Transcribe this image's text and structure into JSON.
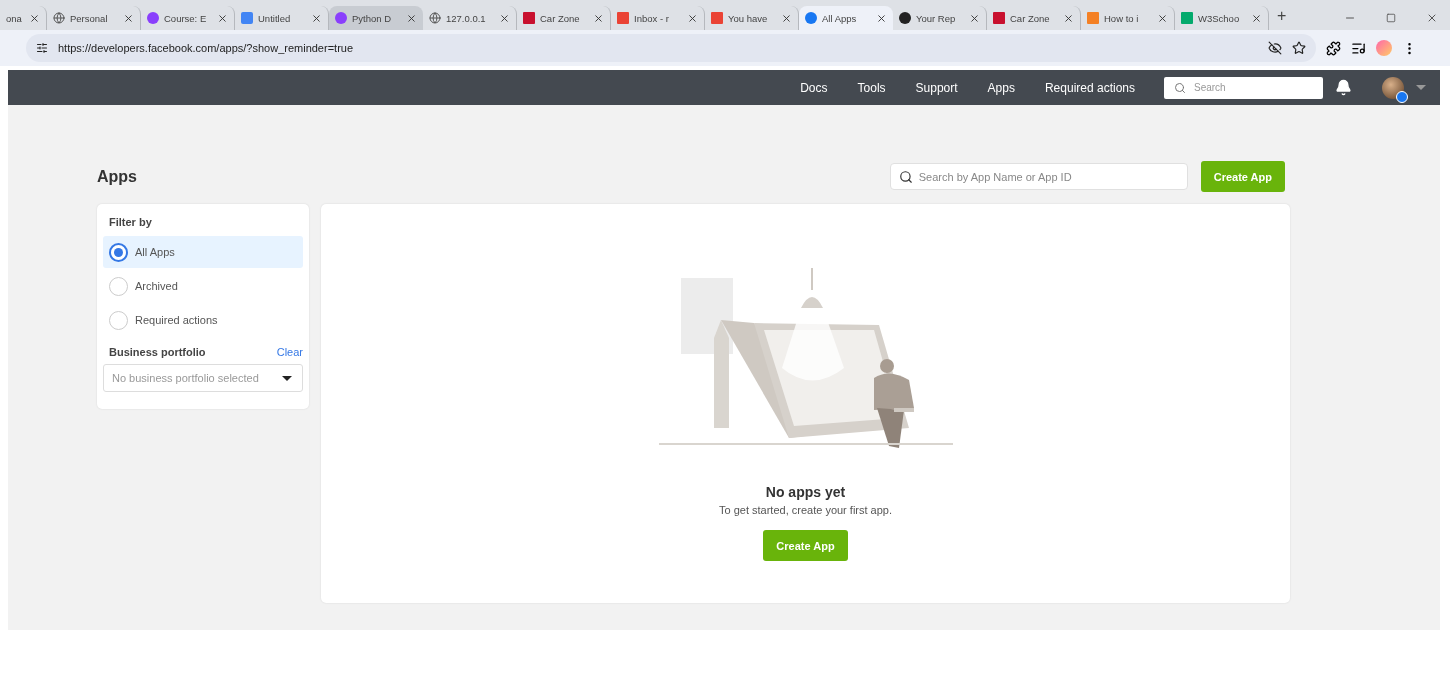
{
  "browser": {
    "tabs": [
      {
        "label": "ona",
        "kind": "plain",
        "selected": false,
        "hovered": false
      },
      {
        "label": "Personal",
        "kind": "globe",
        "selected": false,
        "hovered": false
      },
      {
        "label": "Course: E",
        "kind": "u",
        "selected": false,
        "hovered": false
      },
      {
        "label": "Untitled",
        "kind": "doc",
        "selected": false,
        "hovered": false
      },
      {
        "label": "Python D",
        "kind": "u",
        "selected": false,
        "hovered": true
      },
      {
        "label": "127.0.0.1",
        "kind": "globe",
        "selected": false,
        "hovered": false
      },
      {
        "label": "Car Zone",
        "kind": "flag",
        "selected": false,
        "hovered": false
      },
      {
        "label": "Inbox - r",
        "kind": "mail",
        "selected": false,
        "hovered": false
      },
      {
        "label": "You have",
        "kind": "mail",
        "selected": false,
        "hovered": false
      },
      {
        "label": "All Apps",
        "kind": "fb",
        "selected": true,
        "hovered": false
      },
      {
        "label": "Your Rep",
        "kind": "gh",
        "selected": false,
        "hovered": false
      },
      {
        "label": "Car Zone",
        "kind": "flag",
        "selected": false,
        "hovered": false
      },
      {
        "label": "How to i",
        "kind": "stack",
        "selected": false,
        "hovered": false
      },
      {
        "label": "W3Schoo",
        "kind": "w3",
        "selected": false,
        "hovered": false
      }
    ],
    "new_tab": "+",
    "url": "https://developers.facebook.com/apps/?show_reminder=true"
  },
  "nav": {
    "items": [
      {
        "label": "Docs"
      },
      {
        "label": "Tools"
      },
      {
        "label": "Support"
      },
      {
        "label": "Apps"
      },
      {
        "label": "Required actions"
      }
    ],
    "search_placeholder": "Search"
  },
  "page": {
    "title": "Apps",
    "search_placeholder": "Search by App Name or App ID",
    "create_button": "Create App",
    "filter": {
      "title": "Filter by",
      "options": [
        {
          "label": "All Apps",
          "selected": true
        },
        {
          "label": "Archived",
          "selected": false
        },
        {
          "label": "Required actions",
          "selected": false
        }
      ],
      "portfolio_label": "Business portfolio",
      "clear": "Clear",
      "portfolio_placeholder": "No business portfolio selected"
    },
    "empty": {
      "title": "No apps yet",
      "text": "To get started, create your first app.",
      "button": "Create App"
    }
  }
}
